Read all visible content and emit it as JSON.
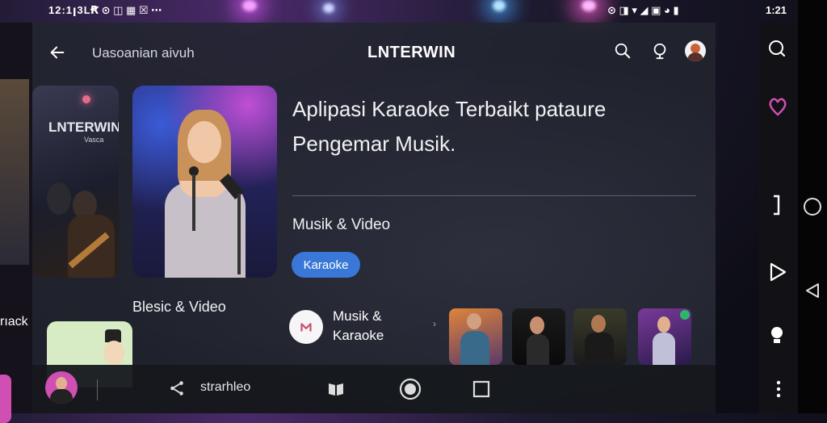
{
  "status_bar": {
    "time_left": "12:1ꞁ3L",
    "time_right": "1:21"
  },
  "app": {
    "subtitle": "Uasoanian aivuh",
    "title": "LNTERWIN"
  },
  "hero_left": {
    "brand": "LNTERWIN",
    "sub": "Vasca"
  },
  "headline": "Aplipasi Karaoke Terbaikt pataure Pengemar Musik.",
  "category": "Musik & Video",
  "chip": "Karaoke",
  "section_label": "Blesic & Video",
  "feature": {
    "label_line1": "Musik &",
    "label_line2": "Karaoke"
  },
  "left_strip_text": "rıack",
  "bottom_nav": {
    "share_label": "strarhleo"
  },
  "colors": {
    "accent": "#3a78d8",
    "card_bg": "#22252e",
    "pink": "#d04fb2"
  }
}
